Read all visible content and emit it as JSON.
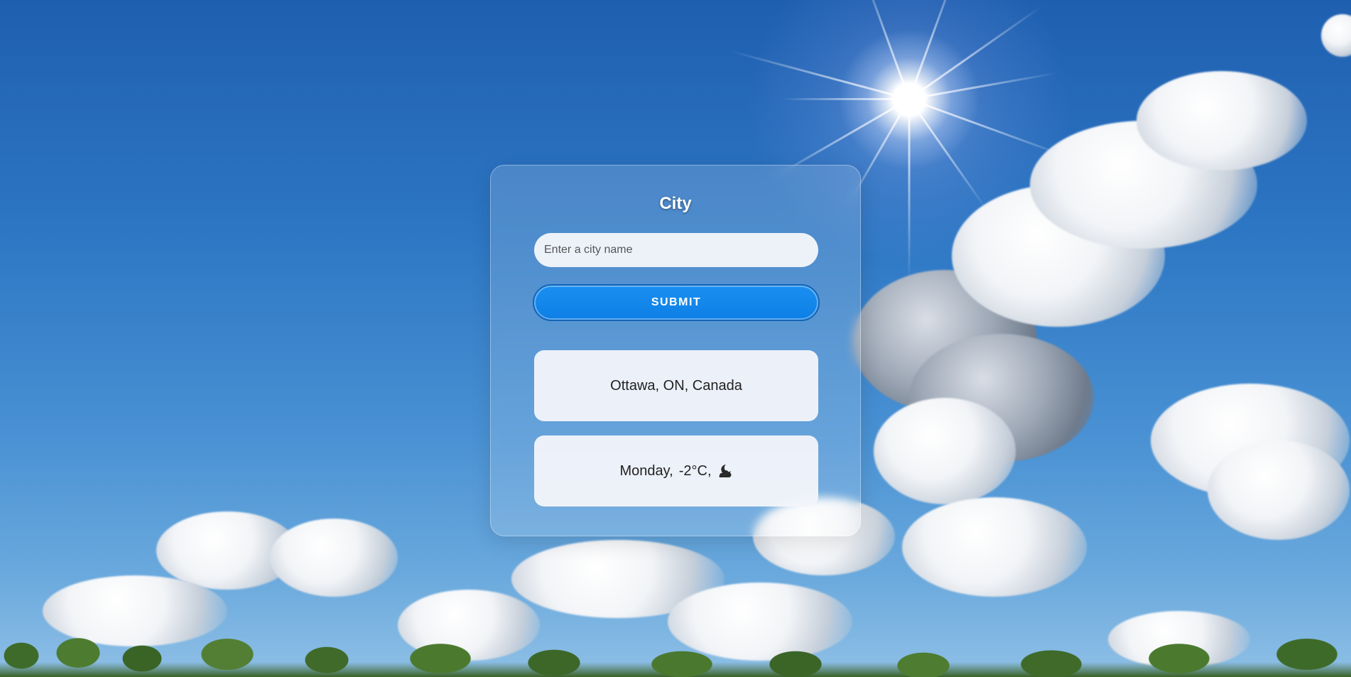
{
  "form": {
    "title": "City",
    "input_placeholder": "Enter a city name",
    "input_value": "",
    "submit_label": "SUBMIT"
  },
  "results": {
    "location": "Ottawa, ON, Canada",
    "day": "Monday,",
    "temperature": "-2°C,",
    "icon": "moon-cloud-icon"
  },
  "colors": {
    "submit_button": "#0d7fe6",
    "sky": "#2d77c4"
  }
}
